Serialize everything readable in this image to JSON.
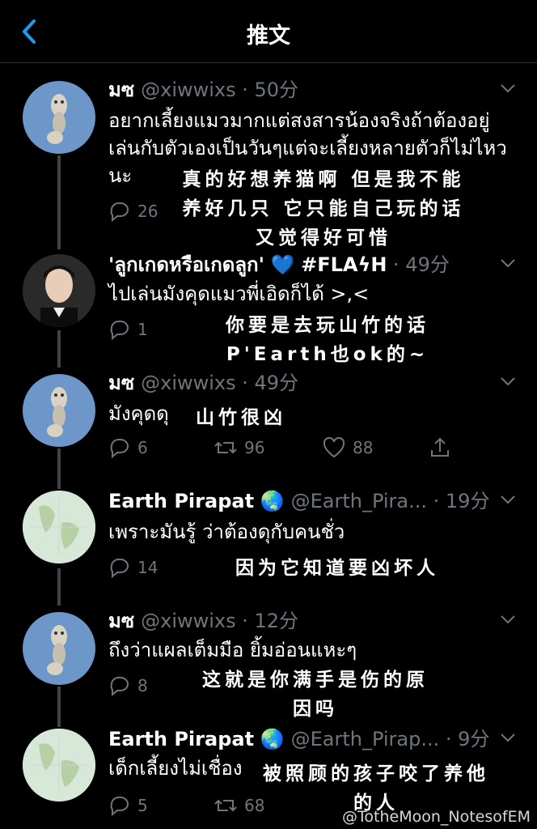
{
  "header": {
    "title": "推文"
  },
  "tweets": [
    {
      "name": "มซ",
      "handle": "@xiwwixs",
      "time": "50分",
      "text": "อยากเลี้ยงแมวมากแต่สงสารน้องจริงถ้าต้องอยู่เล่นกับตัวเองเป็นวันๆแต่จะเลี้ยงหลายตัวก็ไม่ไหวนะ",
      "replies": "26",
      "retweets": "",
      "likes": "",
      "likes_partial": "1",
      "subtitle": [
        "真的好想养猫啊 但是我不能",
        "养好几只 它只能自己玩的话",
        "又觉得好可惜"
      ]
    },
    {
      "name": "'ลูกเกดหรือเกดลูก'",
      "name_suffix": "#FLAϟH",
      "time": "49分",
      "text": "ไปเล่นมังคุดแมวพี่เอิดก็ได้ >,<",
      "replies": "1",
      "retweets": "",
      "likes": "",
      "subtitle": [
        "你要是去玩山竹的话",
        "P'Earth也ok的~"
      ]
    },
    {
      "name": "มซ",
      "handle": "@xiwwixs",
      "time": "49分",
      "text": "มังคุดดุ",
      "replies": "6",
      "retweets": "96",
      "likes": "88",
      "subtitle": [
        "山竹很凶"
      ]
    },
    {
      "name": "Earth Pirapat",
      "handle": "@Earth_Pira...",
      "time": "19分",
      "text": "เพราะมันรู้ ว่าต้องดุกับคนชั่ว",
      "replies": "14",
      "retweets": "",
      "likes": "",
      "subtitle": [
        "因为它知道要凶坏人"
      ]
    },
    {
      "name": "มซ",
      "handle": "@xiwwixs",
      "time": "12分",
      "text": "ถึงว่าแผลเต็มมือ ยิ้มอ่อนแหะๆ",
      "replies": "8",
      "retweets": "",
      "likes": "",
      "subtitle": [
        "这就是你满手是伤的原",
        "因吗"
      ]
    },
    {
      "name": "Earth Pirapat",
      "handle": "@Earth_Pirap...",
      "time": "9分",
      "text": "เด็กเลี้ยงไม่เชื่อง",
      "replies": "5",
      "retweets": "68",
      "likes": "",
      "subtitle": [
        "被照顾的孩子咬了养他",
        "的人"
      ]
    }
  ],
  "watermark": "@TotheMoon_NotesofEM",
  "colors": {
    "background": "#000000",
    "muted": "#6e767d",
    "accent": "#1d9bf0",
    "thread": "#3d4348"
  }
}
